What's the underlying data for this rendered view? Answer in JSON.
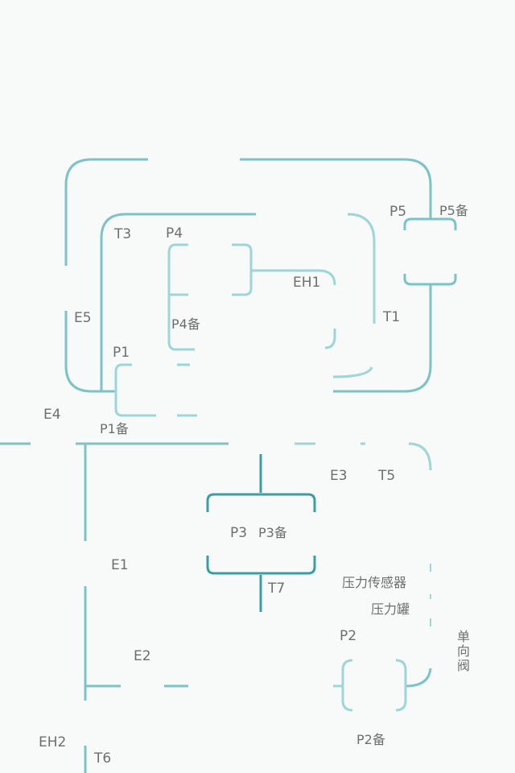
{
  "labels": {
    "t3": "T3",
    "p4": "P4",
    "p5": "P5",
    "p5_spare": "P5备",
    "eh1": "EH1",
    "e5": "E5",
    "p4_spare": "P4备",
    "t1": "T1",
    "p1": "P1",
    "e4": "E4",
    "p1_spare": "P1备",
    "e3": "E3",
    "t5": "T5",
    "p3": "P3",
    "p3_spare": "P3备",
    "e1": "E1",
    "pressure_sensor": "压力传感器",
    "t7": "T7",
    "pressure_tank": "压力罐",
    "p2": "P2",
    "check_valve": "单向阀",
    "e2": "E2",
    "p2_spare": "P2备",
    "eh2": "EH2",
    "t6": "T6"
  },
  "colors": {
    "pipe_main": "#7cc3c6",
    "pipe_light": "#9ed6d8",
    "pipe_dark": "#3a9ea3",
    "text": "#6e6e6e"
  }
}
